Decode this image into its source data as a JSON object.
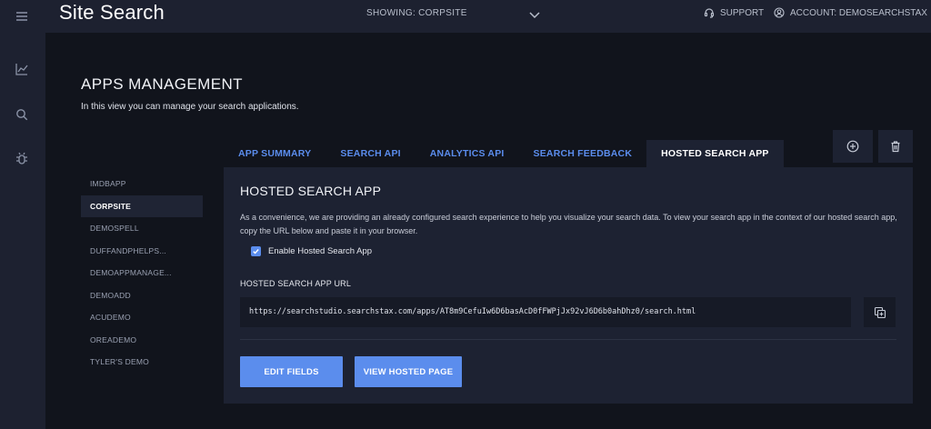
{
  "header": {
    "brand": "Site Search",
    "showing": "SHOWING: CORPSITE",
    "support": "SUPPORT",
    "account": "ACCOUNT: DEMOSEARCHSTAX"
  },
  "rail": {
    "icons": [
      "menu-icon",
      "chart-icon",
      "search-icon",
      "bug-icon"
    ]
  },
  "page": {
    "title": "APPS MANAGEMENT",
    "subtitle": "In this view you can manage your search applications."
  },
  "apps": {
    "items": [
      "IMDBAPP",
      "CORPSITE",
      "DEMOSPELL",
      "DUFFANDPHELPS...",
      "DEMOAPPMANAGE...",
      "DEMOADD",
      "ACUDEMO",
      "OREADEMO",
      "TYLER'S DEMO"
    ],
    "active": "CORPSITE"
  },
  "tabs": {
    "items": [
      "APP SUMMARY",
      "SEARCH API",
      "ANALYTICS API",
      "SEARCH FEEDBACK",
      "HOSTED SEARCH APP"
    ],
    "active": "HOSTED SEARCH APP"
  },
  "panel": {
    "title": "HOSTED SEARCH APP",
    "description": "As a convenience, we are providing an already configured search experience to help you visualize your search data. To view your search app in the context of our hosted search app, copy the URL below and paste it in your browser.",
    "enable_label": "Enable Hosted Search App",
    "enable_checked": true,
    "url_label": "HOSTED SEARCH APP URL",
    "url_value": "https://searchstudio.searchstax.com/apps/AT8m9CefuIw6D6basAcD0fFWPjJx92vJ6D6b0ahDhz0/search.html",
    "edit_fields": "EDIT FIELDS",
    "view_hosted": "VIEW HOSTED PAGE"
  },
  "colors": {
    "accent": "#5b8ded",
    "background": "#11141c",
    "panel": "#1d2232",
    "rail": "#1d2130"
  }
}
